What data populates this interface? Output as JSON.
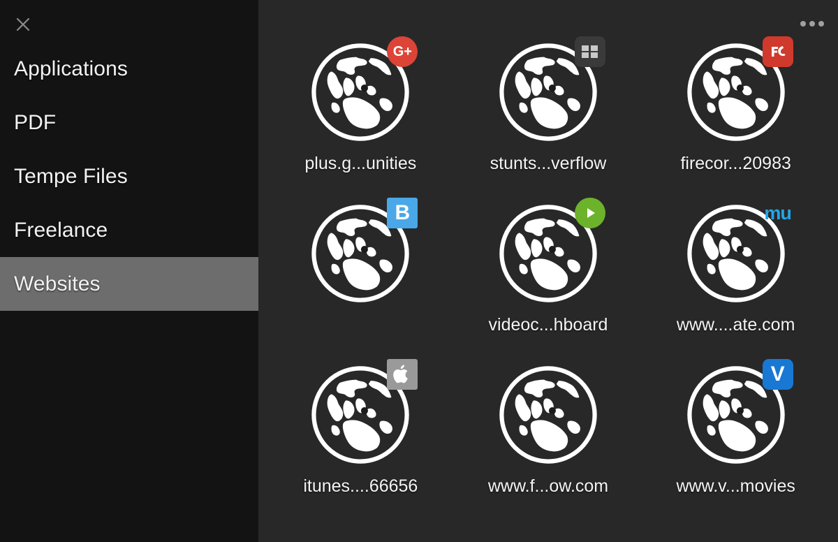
{
  "window": {
    "background_color": "#282828",
    "sidebar_color": "#131313",
    "selection_color": "#6d6d6d",
    "close_icon": "close-icon",
    "more_icon": "more-horizontal-icon"
  },
  "sidebar": {
    "items": [
      {
        "label": "Applications",
        "selected": false
      },
      {
        "label": "PDF",
        "selected": false
      },
      {
        "label": "Tempe Files",
        "selected": false
      },
      {
        "label": "Freelance",
        "selected": false
      },
      {
        "label": "Websites",
        "selected": true
      }
    ]
  },
  "content": {
    "items": [
      {
        "label": "plus.g...unities",
        "icon": "globe-icon",
        "badge": {
          "name": "google-plus-badge",
          "text": "G+",
          "shape": "circ",
          "bg": "#db4437",
          "fg": "#ffffff",
          "font_size": "20px"
        }
      },
      {
        "label": "stunts...verflow",
        "icon": "globe-icon",
        "badge": {
          "name": "grid-squares-badge",
          "text": "",
          "shape": "rsq",
          "bg": "#3a3a3a",
          "fg": "#c9c9c9",
          "font_size": "18px"
        }
      },
      {
        "label": "firecor...20983",
        "icon": "globe-icon",
        "badge": {
          "name": "firecore-badge",
          "text": "FC",
          "shape": "rsq",
          "bg": "#cf3a2c",
          "fg": "#ffffff",
          "font_size": "21px"
        }
      },
      {
        "label": "",
        "icon": "globe-icon",
        "badge": {
          "name": "blogger-b-badge",
          "text": "B",
          "shape": "sq",
          "bg": "#4aa8e8",
          "fg": "#ffffff",
          "font_size": "30px"
        }
      },
      {
        "label": "videoc...hboard",
        "icon": "globe-icon",
        "badge": {
          "name": "play-badge",
          "text": "▶",
          "shape": "circ",
          "bg": "#6cb32b",
          "fg": "#ffffff",
          "font_size": "20px"
        }
      },
      {
        "label": "www....ate.com",
        "icon": "globe-icon",
        "badge": {
          "name": "mu-logo-badge",
          "text": "mu",
          "shape": "none",
          "bg": "transparent",
          "fg": "#23a6e8",
          "font_size": "27px"
        }
      },
      {
        "label": "itunes....66656",
        "icon": "globe-icon",
        "badge": {
          "name": "apple-badge",
          "text": "",
          "shape": "sq",
          "bg": "#9a9a9a",
          "fg": "#ffffff",
          "font_size": "28px"
        }
      },
      {
        "label": "www.f...ow.com",
        "icon": "globe-icon",
        "badge": null
      },
      {
        "label": "www.v...movies",
        "icon": "globe-icon",
        "badge": {
          "name": "vimeo-v-badge",
          "text": "V",
          "shape": "rsq",
          "bg": "#1878d4",
          "fg": "#ffffff",
          "font_size": "30px"
        }
      }
    ]
  }
}
